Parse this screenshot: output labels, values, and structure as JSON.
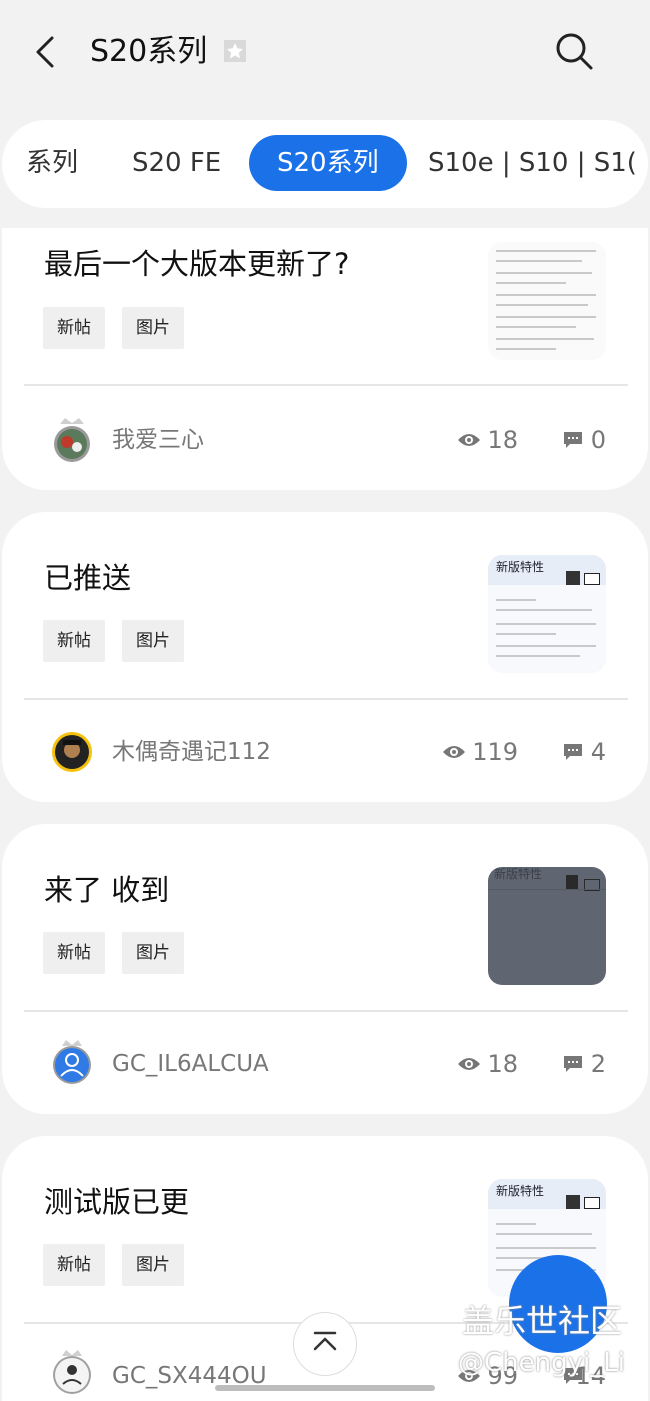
{
  "header": {
    "title": "S20系列"
  },
  "tabs": [
    {
      "label": "系列"
    },
    {
      "label": "S20 FE"
    },
    {
      "label": "S20系列"
    },
    {
      "label": "S10e | S10 | S1("
    }
  ],
  "posts": [
    {
      "title": "最后一个大版本更新了?",
      "tags": [
        "新帖",
        "图片"
      ],
      "author": "我爱三心",
      "views": "18",
      "comments": "0"
    },
    {
      "title": "已推送",
      "tags": [
        "新帖",
        "图片"
      ],
      "author": "木偶奇遇记112",
      "views": "119",
      "comments": "4",
      "thumb_heading": "新版特性"
    },
    {
      "title": "来了 收到",
      "tags": [
        "新帖",
        "图片"
      ],
      "author": "GC_IL6ALCUA",
      "views": "18",
      "comments": "2",
      "thumb_heading": "新版特性"
    },
    {
      "title": "测试版已更",
      "tags": [
        "新帖",
        "图片"
      ],
      "author": "GC_SX444OU",
      "views": "99",
      "comments": "14",
      "thumb_heading": "新版特性"
    }
  ],
  "watermark": {
    "line1": "盖乐世社区",
    "line2": "@Chengyi_Li"
  },
  "colors": {
    "accent": "#1b72e8",
    "card": "#ffffff",
    "background": "#f2f2f2"
  }
}
